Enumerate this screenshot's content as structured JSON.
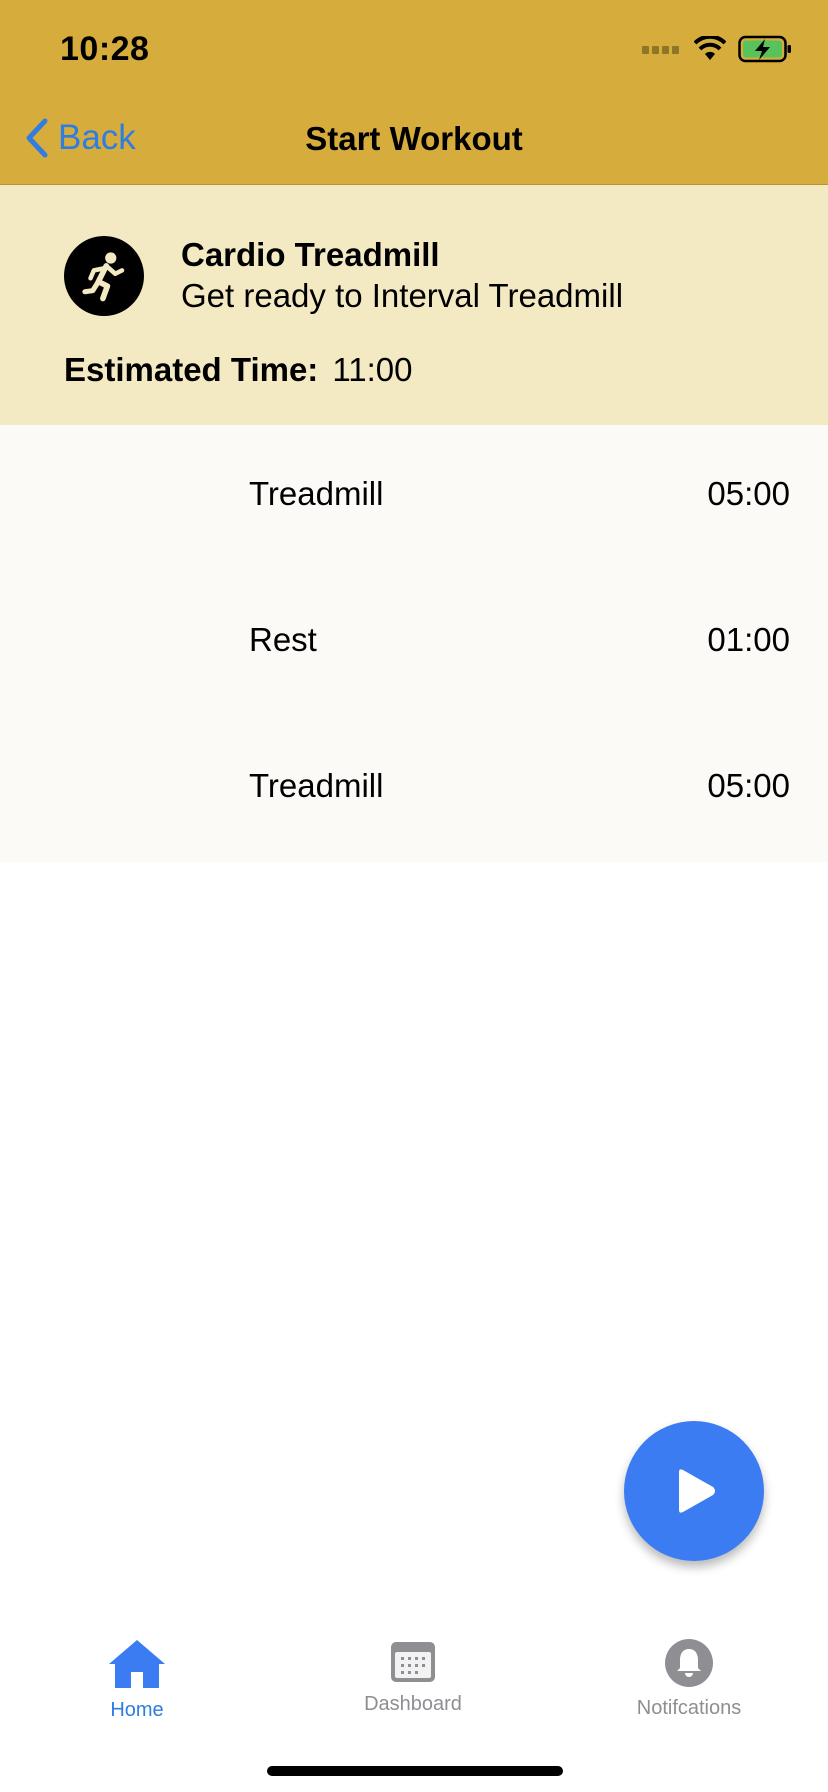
{
  "status": {
    "time": "10:28"
  },
  "nav": {
    "back_label": "Back",
    "title": "Start Workout"
  },
  "workout": {
    "title": "Cardio Treadmill",
    "subtitle": "Get ready to Interval Treadmill",
    "estimated_label": "Estimated Time:",
    "estimated_value": "11:00"
  },
  "steps": [
    {
      "name": "Treadmill",
      "duration": "05:00"
    },
    {
      "name": "Rest",
      "duration": "01:00"
    },
    {
      "name": "Treadmill",
      "duration": "05:00"
    }
  ],
  "tabs": [
    {
      "label": "Home",
      "icon": "home-icon",
      "active": true
    },
    {
      "label": "Dashboard",
      "icon": "calendar-icon",
      "active": false
    },
    {
      "label": "Notifcations",
      "icon": "bell-icon",
      "active": false
    }
  ],
  "colors": {
    "bar": "#d6ad3c",
    "header": "#f3e9c2",
    "list": "#fbfaf6",
    "accent": "#2f7de1",
    "fab": "#3b7cf2"
  }
}
